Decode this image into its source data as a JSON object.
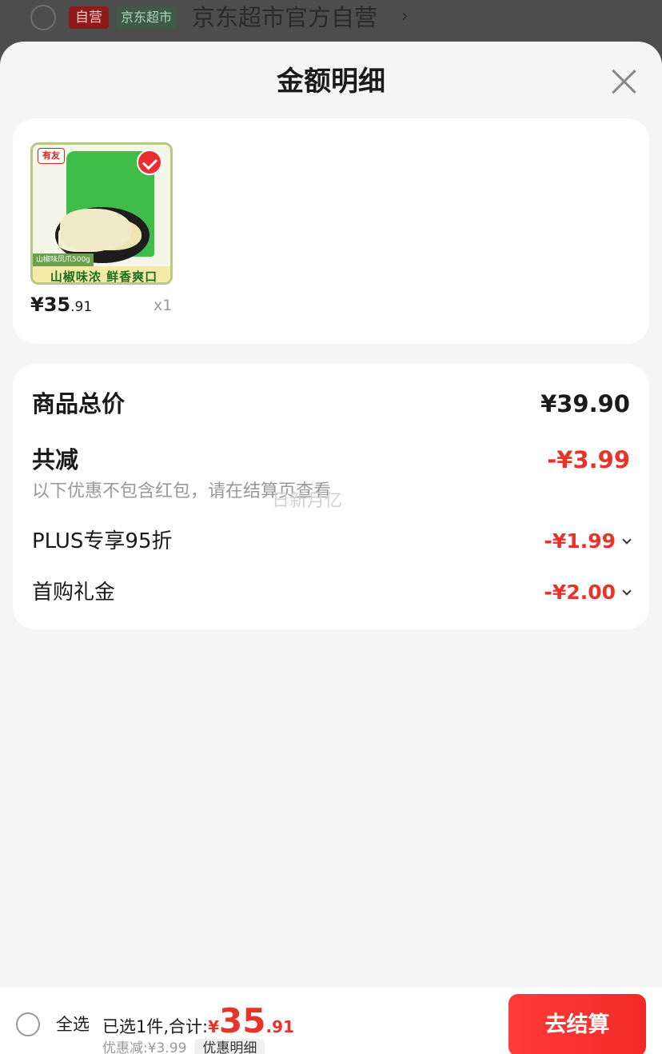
{
  "store_bar": {
    "tag_self": "自营",
    "tag_channel": "京东超市",
    "store_name": "京东超市官方自营",
    "chevron": "›"
  },
  "sheet": {
    "title": "金额明细",
    "close_icon": "close-icon"
  },
  "product": {
    "brand": "有友",
    "image_caption": "山椒味凤爪500g",
    "image_band": "山椒味浓  鲜香爽口",
    "selected": true,
    "price_int": "¥35",
    "price_dec": ".91",
    "quantity": "x1"
  },
  "detail": {
    "total_label": "商品总价",
    "total_value": "¥39.90",
    "reduce_label": "共减",
    "reduce_value": "-¥3.99",
    "note": "以下优惠不包含红包，请在结算页查看",
    "watermark": "日新月亿",
    "items": [
      {
        "label": "PLUS专享95折",
        "value": "-¥1.99"
      },
      {
        "label": "首购礼金",
        "value": "-¥2.00"
      }
    ]
  },
  "bottom": {
    "select_all": "全选",
    "selected_text": "已选1件,合计:",
    "currency": "¥",
    "total_int": "35",
    "total_dec": ".91",
    "discount_text": "优惠减:¥3.99",
    "discount_detail": "优惠明细",
    "checkout": "去结算"
  },
  "colors": {
    "accent_red": "#e8332a",
    "checkout_red": "#f12a26"
  }
}
